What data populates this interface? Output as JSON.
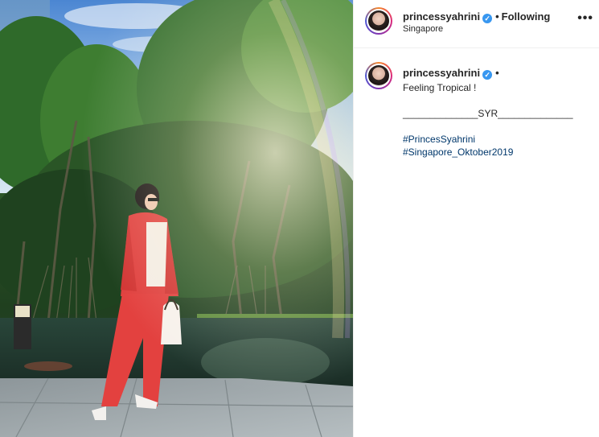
{
  "post": {
    "username": "princessyahrini",
    "verified_mark": "✓",
    "separator": "•",
    "follow_status": "Following",
    "location": "Singapore",
    "more_icon": "•••"
  },
  "caption": {
    "username": "princessyahrini",
    "verified_mark": "✓",
    "separator": "•",
    "line1": "Feeling Tropical !",
    "line2": "______________SYR______________",
    "hashtags": [
      "#PrincesSyahrini",
      "#Singapore_Oktober2019"
    ]
  }
}
